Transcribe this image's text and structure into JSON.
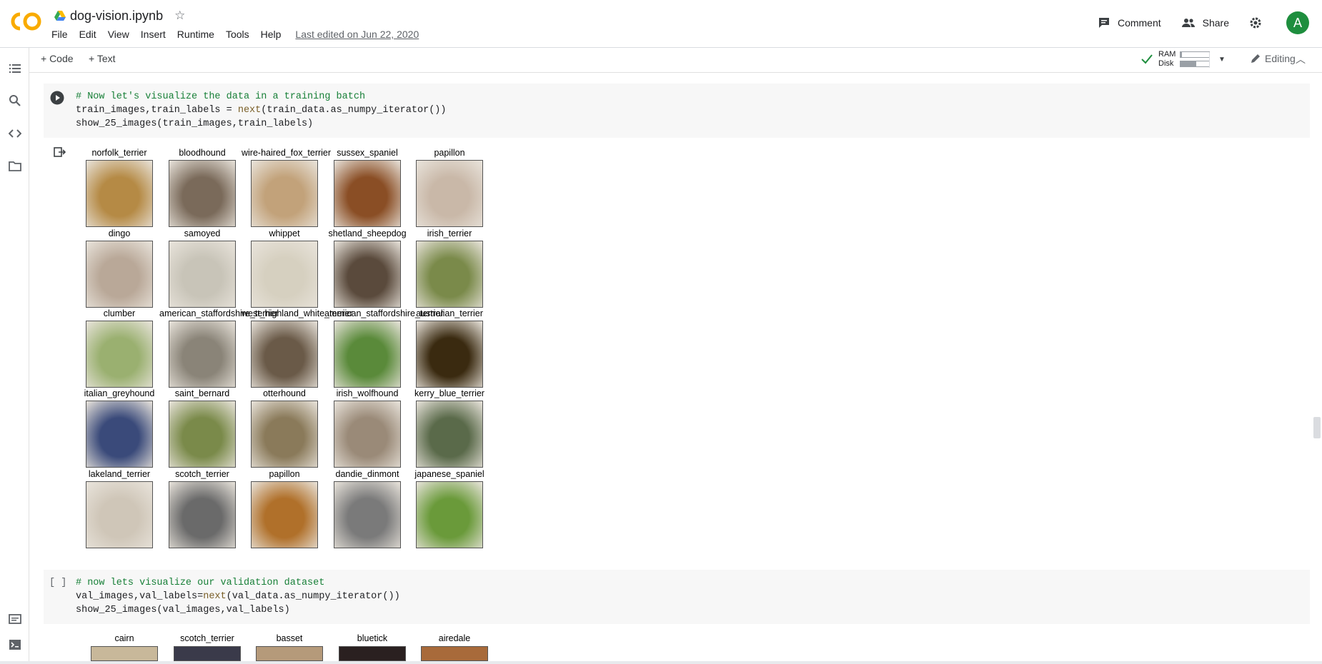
{
  "header": {
    "doc_title": "dog-vision.ipynb",
    "menu": [
      "File",
      "Edit",
      "View",
      "Insert",
      "Runtime",
      "Tools",
      "Help"
    ],
    "last_edited": "Last edited on Jun 22, 2020",
    "comment_label": "Comment",
    "share_label": "Share",
    "avatar_letter": "A"
  },
  "toolbar": {
    "add_code": "+ Code",
    "add_text": "+ Text",
    "ram_label": "RAM",
    "disk_label": "Disk",
    "ram_fraction": 0.05,
    "disk_fraction": 0.55,
    "editing_label": "Editing"
  },
  "cell1": {
    "comment": "# Now let's visualize the data in a training batch",
    "line2_pre": "train_images,train_labels = ",
    "line2_fn": "next",
    "line2_post": "(train_data.as_numpy_iterator())",
    "line3": "show_25_images(train_images,train_labels)"
  },
  "cell2": {
    "bracket": "[ ]",
    "comment": "# now lets visualize our validation dataset",
    "line2_pre": "val_images,val_labels=",
    "line2_fn": "next",
    "line2_post": "(val_data.as_numpy_iterator())",
    "line3": "show_25_images(val_images,val_labels)"
  },
  "train_grid": [
    [
      "norfolk_terrier",
      "bloodhound",
      "wire-haired_fox_terrier",
      "sussex_spaniel",
      "papillon"
    ],
    [
      "dingo",
      "samoyed",
      "whippet",
      "shetland_sheepdog",
      "irish_terrier"
    ],
    [
      "clumber",
      "american_staffordshire_terrier",
      "west_highland_white_terrier",
      "american_staffordshire_terrier",
      "australian_terrier"
    ],
    [
      "italian_greyhound",
      "saint_bernard",
      "otterhound",
      "irish_wolfhound",
      "kerry_blue_terrier"
    ],
    [
      "lakeland_terrier",
      "scotch_terrier",
      "papillon",
      "dandie_dinmont",
      "japanese_spaniel"
    ]
  ],
  "val_grid_first_row": [
    "cairn",
    "scotch_terrier",
    "basset",
    "bluetick",
    "airedale"
  ],
  "thumb_colors": [
    [
      "#b58a45",
      "#7a6a5a",
      "#c2a27a",
      "#8a4e25",
      "#c9b8a8"
    ],
    [
      "#b9a898",
      "#c8c4b8",
      "#d6d0c0",
      "#5a4a3c",
      "#7a8a4a"
    ],
    [
      "#9ab070",
      "#8a8478",
      "#6a5a48",
      "#5a8a3a",
      "#3a2a10"
    ],
    [
      "#3a4a7a",
      "#7a8a4a",
      "#8a7a5a",
      "#9a8a78",
      "#5a6a4a"
    ],
    [
      "#cfc6b8",
      "#6a6a6a",
      "#b0702a",
      "#7a7a7a",
      "#6a9a3a"
    ]
  ],
  "val_thumb_colors": [
    "#c8b89a",
    "#3a3a4a",
    "#b59a7a",
    "#2a2020",
    "#a86a3a"
  ]
}
